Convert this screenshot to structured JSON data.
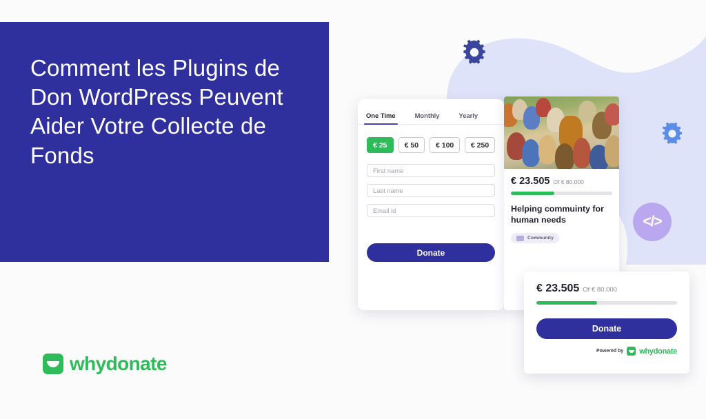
{
  "background_color": "#fbfbfb",
  "colors": {
    "brand_indigo": "#302f9e",
    "brand_green": "#2fbb5a",
    "blob_lavender": "#dfe3fa",
    "code_badge_purple": "#b9a8ef",
    "gear_dark_blue": "#3a469c",
    "gear_light_blue": "#5b8ce8"
  },
  "title_panel": {
    "heading": "Comment les Plugins de Don WordPress Peuvent Aider Votre Collecte de Fonds"
  },
  "brand": {
    "name": "whydonate",
    "logo_icon": "whydonate-logo-icon"
  },
  "decor": {
    "gear_top_icon": "gear-icon",
    "gear_right_icon": "gear-icon",
    "code_badge_icon": "code-icon",
    "code_badge_glyph": "</>"
  },
  "donation_form": {
    "tabs": [
      {
        "label": "One Time",
        "active": true
      },
      {
        "label": "Monthly",
        "active": false
      },
      {
        "label": "Yearly",
        "active": false
      }
    ],
    "amounts": [
      {
        "label": "€ 25",
        "selected": true
      },
      {
        "label": "€ 50",
        "selected": false
      },
      {
        "label": "€ 100",
        "selected": false
      },
      {
        "label": "€ 250",
        "selected": false
      }
    ],
    "fields": [
      {
        "placeholder": "First name"
      },
      {
        "placeholder": "Last name"
      },
      {
        "placeholder": "Email id"
      }
    ],
    "submit_label": "Donate"
  },
  "campaign_card": {
    "photo_alt": "campaign-photo",
    "raised": "€ 23.505",
    "goal_text": "Of € 80.000",
    "progress_percent": 43,
    "title": "Helping commuinty for human needs",
    "tag": {
      "label": "Community",
      "icon": "community-icon"
    }
  },
  "widget_card": {
    "raised": "€ 23.505",
    "goal_text": "Of € 80.000",
    "progress_percent": 43,
    "donate_label": "Donate",
    "powered_by_label": "Powered by",
    "powered_by_brand": "whydonate"
  }
}
